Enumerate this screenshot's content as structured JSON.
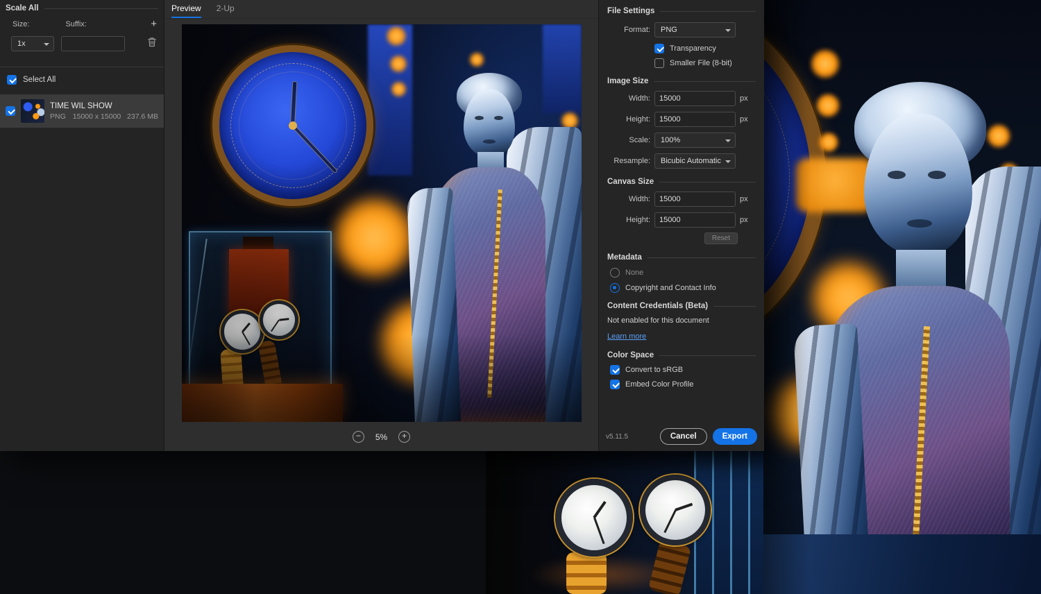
{
  "left": {
    "scale_all": "Scale All",
    "size_label": "Size:",
    "suffix_label": "Suffix:",
    "scale_value": "1x",
    "suffix_value": "",
    "select_all": "Select All",
    "asset": {
      "title": "TIME WIL SHOW",
      "format": "PNG",
      "dimensions": "15000 x 15000",
      "file_size": "237.6 MB"
    }
  },
  "tabs": {
    "preview": "Preview",
    "two_up": "2-Up"
  },
  "zoom": {
    "out": "−",
    "value": "5%",
    "in": "+"
  },
  "icons": {
    "add_scale": "+"
  },
  "file_settings": {
    "header": "File Settings",
    "format_label": "Format:",
    "format_value": "PNG",
    "transparency": "Transparency",
    "smaller_file": "Smaller File (8-bit)"
  },
  "image_size": {
    "header": "Image Size",
    "width_label": "Width:",
    "width_value": "15000",
    "height_label": "Height:",
    "height_value": "15000",
    "unit": "px",
    "scale_label": "Scale:",
    "scale_value": "100%",
    "resample_label": "Resample:",
    "resample_value": "Bicubic Automatic"
  },
  "canvas_size": {
    "header": "Canvas Size",
    "width_label": "Width:",
    "width_value": "15000",
    "height_label": "Height:",
    "height_value": "15000",
    "unit": "px",
    "reset": "Reset"
  },
  "metadata": {
    "header": "Metadata",
    "none": "None",
    "copyright": "Copyright and Contact Info"
  },
  "content_credentials": {
    "header": "Content Credentials (Beta)",
    "status": "Not enabled for this document",
    "learn_more": "Learn more"
  },
  "color_space": {
    "header": "Color Space",
    "convert": "Convert to sRGB",
    "embed": "Embed Color Profile"
  },
  "footer": {
    "version": "v5.11.5",
    "cancel": "Cancel",
    "export": "Export"
  },
  "colors": {
    "accent": "#1473e6",
    "link": "#5aa0f6"
  }
}
